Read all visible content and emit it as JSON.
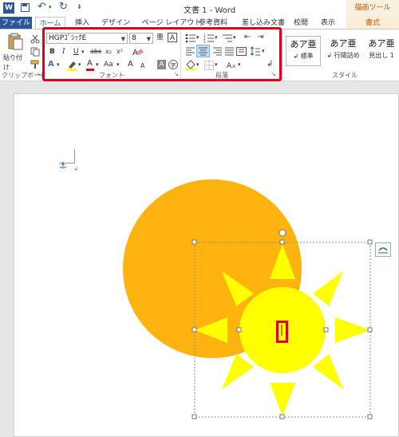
{
  "titlebar": {
    "doc_title": "文書 1 - Word",
    "context_tool_title": "描画ツール",
    "word_icon_letter": "W"
  },
  "tabs": {
    "file": "ファイル",
    "home": "ホーム",
    "insert": "挿入",
    "design": "デザイン",
    "page_layout": "ページ レイアウト",
    "references": "参考資料",
    "mailings": "差し込み文書",
    "review": "校閲",
    "view": "表示",
    "format": "書式"
  },
  "ribbon": {
    "clipboard": {
      "paste_label": "貼り付け",
      "group_label": "クリップボード"
    },
    "font": {
      "font_name": "HGPｺﾞｼｯｸE",
      "font_size": "8",
      "group_label": "フォント",
      "bold": "B",
      "italic": "I",
      "underline": "U",
      "strike": "abc",
      "subscript": "x₂",
      "superscript": "x²",
      "grow": "A",
      "shrink": "A",
      "change_case": "Aa",
      "font_color_letter": "A",
      "char_shade": "A",
      "enclose": "字"
    },
    "paragraph": {
      "group_label": "段落"
    },
    "styles": {
      "group_label": "スタイル",
      "items": [
        {
          "preview": "あア亜",
          "name": "標準"
        },
        {
          "preview": "あア亜",
          "name": "行間詰め"
        },
        {
          "preview": "あア亜",
          "name": "見出し 1"
        }
      ]
    }
  },
  "colors": {
    "accent": "#2b579a",
    "highlight_red": "#e0001b",
    "orange_circle": "#ffb30f",
    "sun_yellow": "#ffff00"
  }
}
